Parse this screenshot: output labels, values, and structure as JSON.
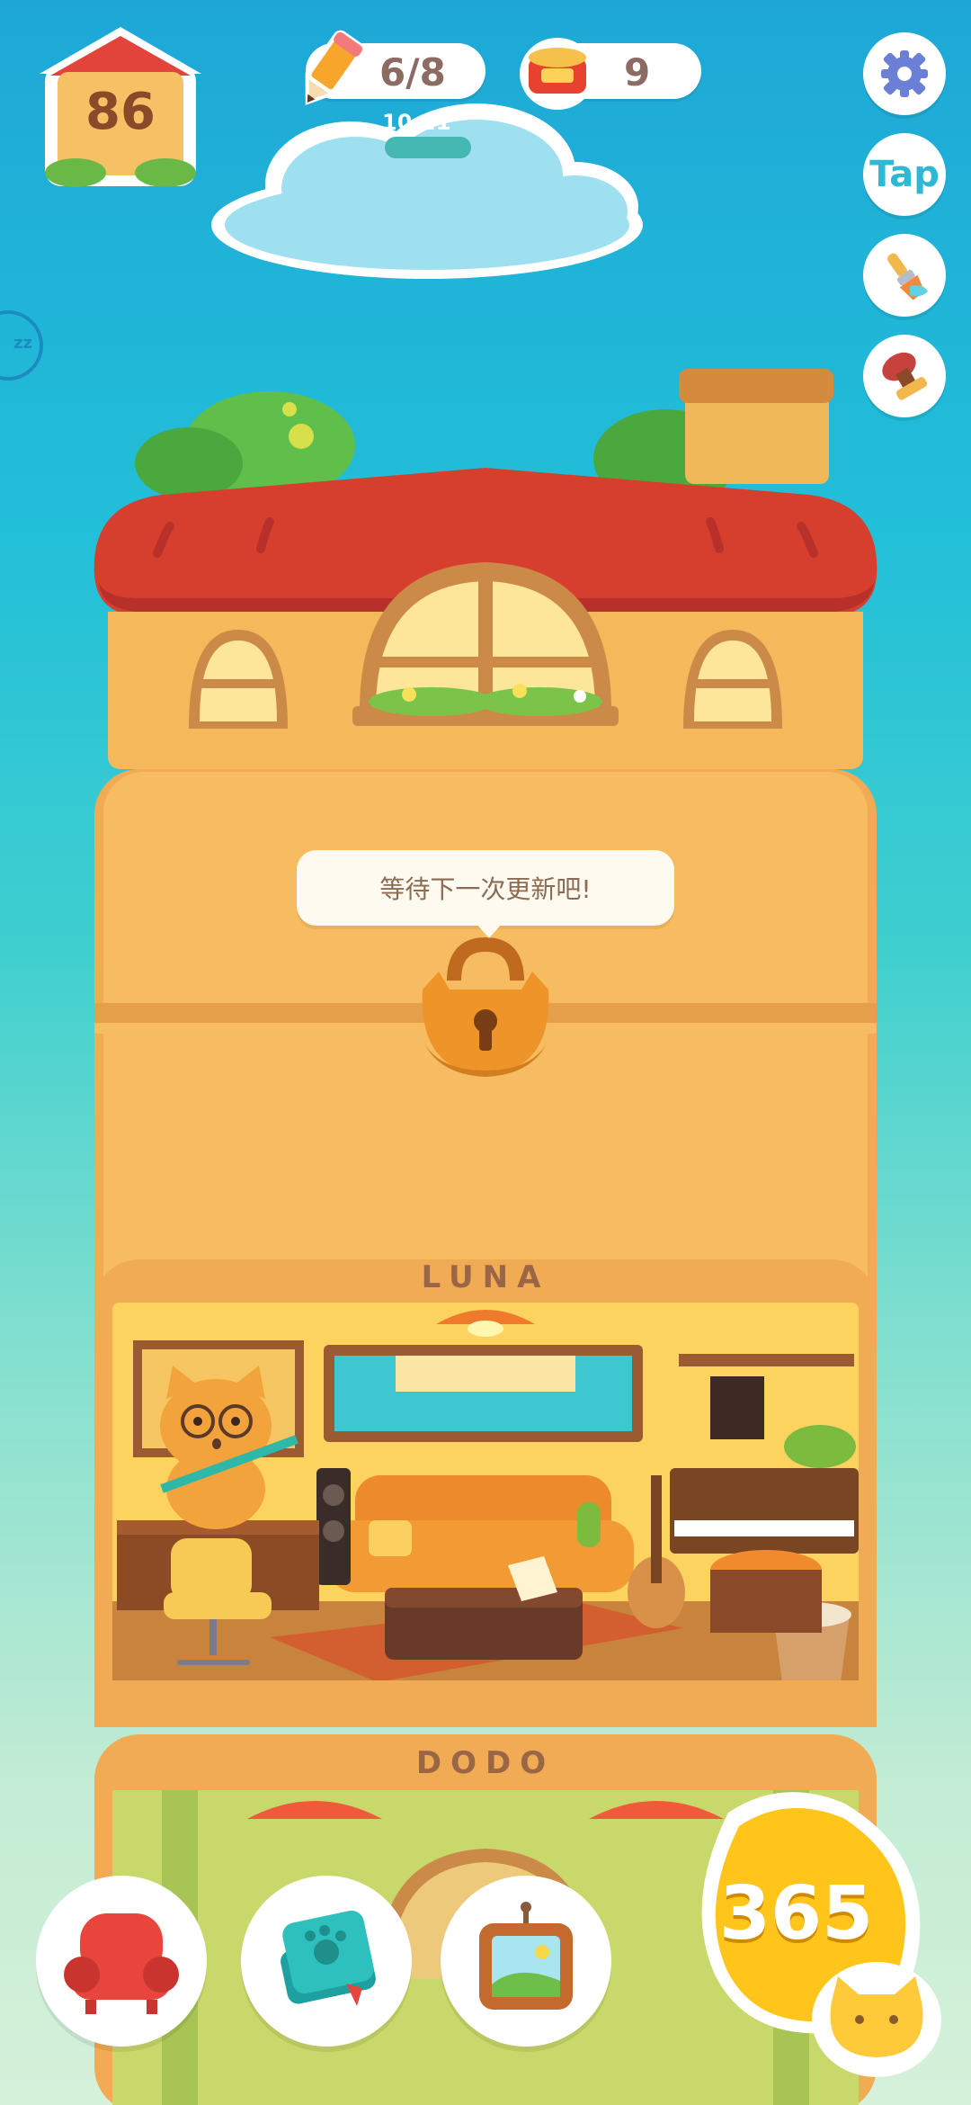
{
  "hud": {
    "house_level": "86",
    "pencil": {
      "value": "6/8",
      "timer": "10:21"
    },
    "cans": {
      "value": "9"
    },
    "side_buttons": [
      {
        "name": "settings",
        "icon": "gear-icon"
      },
      {
        "name": "tap",
        "label": "Tap"
      },
      {
        "name": "paint",
        "icon": "paint-brush-icon"
      },
      {
        "name": "stamp",
        "icon": "stamp-icon"
      }
    ]
  },
  "building": {
    "locked_message": "等待下一次更新吧!",
    "floors": [
      {
        "name": "LUNA"
      },
      {
        "name": "DODO"
      }
    ]
  },
  "dock": {
    "buttons": [
      {
        "name": "furniture",
        "icon": "armchair-icon"
      },
      {
        "name": "journal",
        "icon": "paw-book-icon"
      },
      {
        "name": "gallery",
        "icon": "picture-frame-icon"
      }
    ],
    "days_count": "365"
  },
  "colors": {
    "roof_red": "#d63f2e",
    "wall_orange": "#f5b85b",
    "sky_top": "#1ea7d6",
    "sky_bottom": "#d6f1da",
    "accent_yellow": "#ffc51a"
  }
}
